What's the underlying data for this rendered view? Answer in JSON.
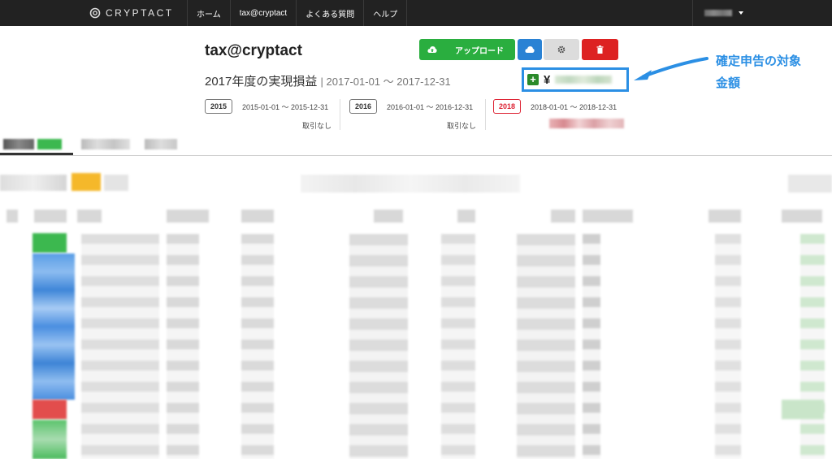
{
  "navbar": {
    "brand": "CRYPTACT",
    "items": [
      "ホーム",
      "tax@cryptact",
      "よくある質問",
      "ヘルプ"
    ]
  },
  "header": {
    "title": "tax@cryptact",
    "subtitle_main": "2017年度の実現損益",
    "subtitle_range": "| 2017-01-01 〜 2017-12-31"
  },
  "buttons": {
    "upload_label": "アップロード"
  },
  "amount": {
    "currency": "¥",
    "sign": "+"
  },
  "annotation": {
    "line1": "確定申告の対象",
    "line2": "金額",
    "color": "#2b8fe4"
  },
  "years": [
    {
      "year": "2015",
      "range": "2015-01-01 〜 2015-12-31",
      "note": "取引なし"
    },
    {
      "year": "2016",
      "range": "2016-01-01 〜 2016-12-31",
      "note": "取引なし"
    },
    {
      "year": "2018",
      "range": "2018-01-01 〜 2018-12-31",
      "note": ""
    }
  ],
  "colors": {
    "navbar": "#222222",
    "success": "#2aae3f",
    "primary": "#2a82d4",
    "danger": "#dd2222"
  }
}
